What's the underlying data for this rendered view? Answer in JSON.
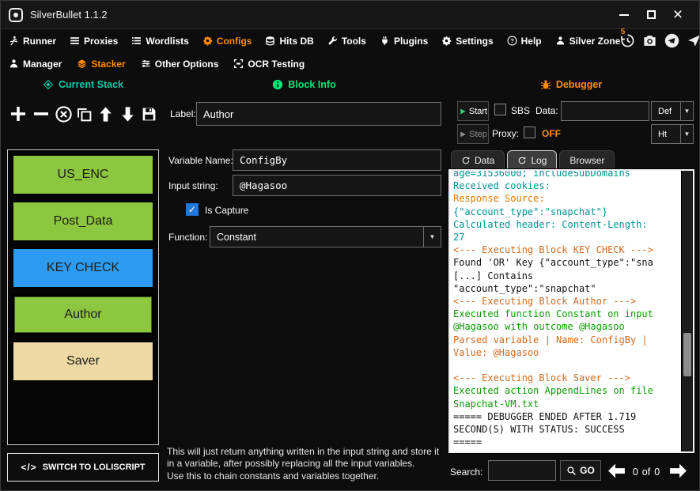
{
  "window": {
    "title": "SilverBullet 1.1.2"
  },
  "icons": {
    "close": "×",
    "caret_down": "▼",
    "check": "✓",
    "code_glyph": "</>"
  },
  "nav": {
    "active_color": "#ff8c00",
    "items": [
      {
        "id": "runner",
        "label": "Runner",
        "icon": "runner-icon",
        "active": false
      },
      {
        "id": "proxies",
        "label": "Proxies",
        "icon": "proxies-icon",
        "active": false
      },
      {
        "id": "wordlists",
        "label": "Wordlists",
        "icon": "wordlists-icon",
        "active": false
      },
      {
        "id": "configs",
        "label": "Configs",
        "icon": "configs-icon",
        "active": true
      },
      {
        "id": "hits-db",
        "label": "Hits DB",
        "icon": "hitsdb-icon",
        "active": false
      },
      {
        "id": "tools",
        "label": "Tools",
        "icon": "tools-icon",
        "active": false
      },
      {
        "id": "plugins",
        "label": "Plugins",
        "icon": "plugins-icon",
        "active": false
      },
      {
        "id": "settings",
        "label": "Settings",
        "icon": "settings-icon",
        "active": false
      },
      {
        "id": "help",
        "label": "Help",
        "icon": "help-icon",
        "active": false
      },
      {
        "id": "silver-zone",
        "label": "Silver Zone",
        "icon": "silverzone-icon",
        "active": false,
        "badge": "5"
      }
    ],
    "quick_icons": [
      "history-icon",
      "screenshot-icon",
      "telegram-icon",
      "share-icon"
    ]
  },
  "subnav": {
    "items": [
      {
        "id": "manager",
        "label": "Manager",
        "icon": "manager-icon",
        "active": false
      },
      {
        "id": "stacker",
        "label": "Stacker",
        "icon": "stacker-icon",
        "active": true
      },
      {
        "id": "other-options",
        "label": "Other Options",
        "icon": "options-icon",
        "active": false
      },
      {
        "id": "ocr-testing",
        "label": "OCR Testing",
        "icon": "ocr-icon",
        "active": false
      }
    ]
  },
  "stack": {
    "title": "Current Stack",
    "title_color": "#00c9a7",
    "blocks": [
      {
        "label": "US_ENC",
        "color": "#8dc63f",
        "selected": false
      },
      {
        "label": "Post_Data",
        "color": "#8dc63f",
        "selected": false
      },
      {
        "label": "KEY CHECK",
        "color": "#2d9bf0",
        "selected": false
      },
      {
        "label": "Author",
        "color": "#8dc63f",
        "selected": true
      },
      {
        "label": "Saver",
        "color": "#eed9a4",
        "selected": false
      }
    ],
    "switch_button": "SWITCH TO LOLISCRIPT"
  },
  "block_info": {
    "title": "Block Info",
    "title_color": "#00e676",
    "fields": {
      "label": {
        "label": "Label:",
        "value": "Author"
      },
      "variable_name": {
        "label": "Variable Name:",
        "value": "ConfigBy"
      },
      "input_string": {
        "label": "Input string:",
        "value": "@Hagasoo"
      },
      "is_capture": {
        "label": "Is Capture",
        "checked": true
      },
      "function": {
        "label": "Function:",
        "value": "Constant"
      }
    },
    "description_line1": "This will just return anything written in the input string and store it in a variable, after possibly replacing all the input variables.",
    "description_line2": "Use this to chain constants and variables together."
  },
  "debugger": {
    "title": "Debugger",
    "title_color": "#ff8c00",
    "start_button": "Start",
    "step_button": "Step",
    "sbs_label": "SBS",
    "data_label": "Data:",
    "data_value": "",
    "wordlist_type": "Def",
    "proxy_label": "Proxy:",
    "proxy_status": "OFF",
    "proxy_type": "Ht",
    "tabs": [
      {
        "label": "Data",
        "icon": "refresh-icon",
        "active": false
      },
      {
        "label": "Log",
        "icon": "refresh-icon",
        "active": true
      },
      {
        "label": "Browser",
        "active": false
      }
    ],
    "log": [
      {
        "text": "age=31536000; includeSubDomains",
        "color": "#009090"
      },
      {
        "text": "Received cookies:",
        "color": "#009090"
      },
      {
        "text": "Response Source:",
        "color": "#e07b00"
      },
      {
        "text": "{\"account_type\":\"snapchat\"}",
        "color": "#009090"
      },
      {
        "text": "Calculated header: Content-Length:",
        "color": "#009090"
      },
      {
        "text": "27",
        "color": "#009090"
      },
      {
        "text": "<--- Executing Block KEY CHECK --->",
        "color": "#d2691e"
      },
      {
        "text": "Found 'OR' Key {\"account_type\":\"sna",
        "color": "#111111"
      },
      {
        "text": "[...] Contains",
        "color": "#111111"
      },
      {
        "text": "\"account_type\":\"snapchat\"",
        "color": "#111111"
      },
      {
        "text": "<--- Executing Block Author --->",
        "color": "#d2691e"
      },
      {
        "text": "Executed function Constant on input",
        "color": "#0a9b00"
      },
      {
        "text": "@Hagasoo with outcome @Hagasoo",
        "color": "#0a9b00"
      },
      {
        "text": "Parsed variable | Name: ConfigBy |",
        "color": "#d2691e"
      },
      {
        "text": "Value: @Hagasoo",
        "color": "#d2691e"
      },
      {
        "text": "",
        "color": "#111111"
      },
      {
        "text": "<--- Executing Block Saver --->",
        "color": "#d2691e"
      },
      {
        "text": "Executed action AppendLines on file",
        "color": "#0a9b00"
      },
      {
        "text": "Snapchat-VM.txt",
        "color": "#0a9b00"
      },
      {
        "text": "===== DEBUGGER ENDED AFTER 1.719",
        "color": "#111111"
      },
      {
        "text": "SECOND(S) WITH STATUS: SUCCESS",
        "color": "#111111"
      },
      {
        "text": "=====",
        "color": "#111111"
      }
    ],
    "search": {
      "label": "Search:",
      "value": "",
      "go_label": "GO",
      "current": "0",
      "of_label": "of",
      "total": "0"
    }
  }
}
